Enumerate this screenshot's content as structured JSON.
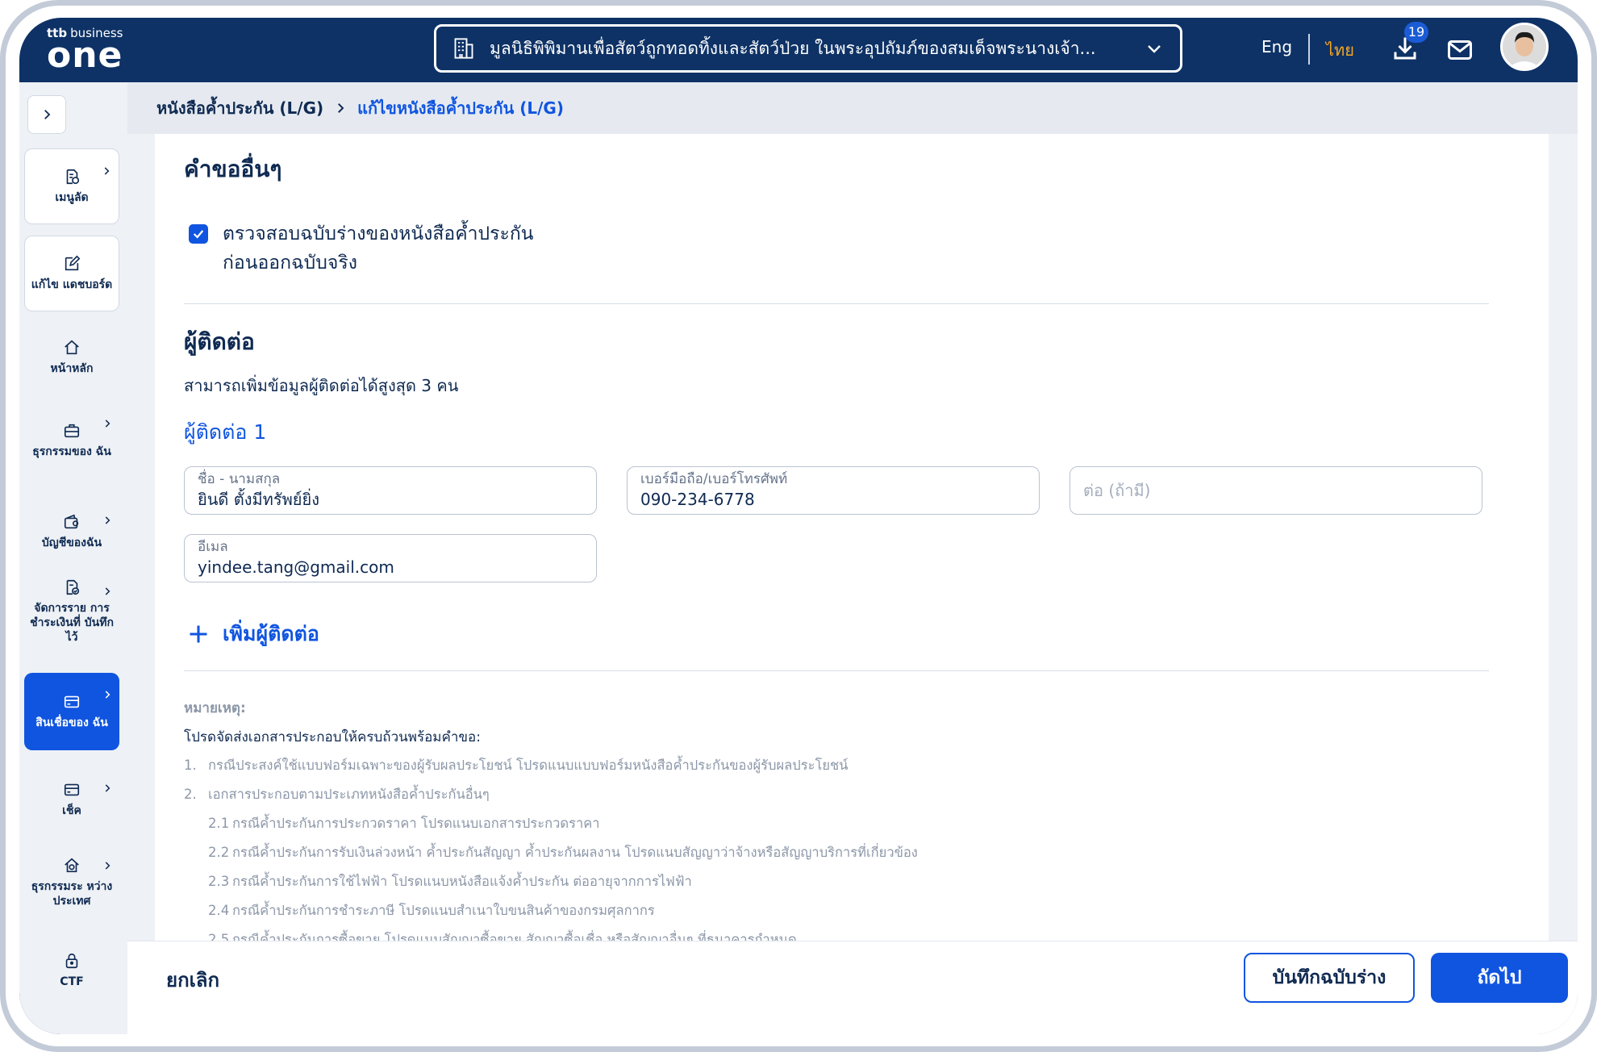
{
  "header": {
    "logo_brand": "ttb",
    "logo_business": "business",
    "logo_main": "one",
    "company_name": "มูลนิธิพิพิมานเพื่อสัตว์ถูกทอดทิ้งและสัตว์ป่วย ในพระอุปถัมภ์ของสมเด็จพระนางเจ้า...",
    "lang_en": "Eng",
    "lang_th": "ไทย",
    "download_badge": "19",
    "accent_color": "#1055e0",
    "active_lang_color": "#f5a623"
  },
  "sidebar": {
    "items": [
      {
        "label": "เมนูลัด",
        "icon": "document-star-icon"
      },
      {
        "label": "แก้ไข แดชบอร์ด",
        "icon": "edit-icon"
      },
      {
        "label": "หน้าหลัก",
        "icon": "home-icon"
      },
      {
        "label": "ธุรกรรมของ ฉัน",
        "icon": "briefcase-icon"
      },
      {
        "label": "บัญชีของฉัน",
        "icon": "wallet-icon"
      },
      {
        "label": "จัดการราย การชำระเงินที่ บันทึกไว้",
        "icon": "document-check-icon"
      },
      {
        "label": "สินเชื่อของ ฉัน",
        "icon": "card-icon"
      },
      {
        "label": "เช็ค",
        "icon": "cheque-icon"
      },
      {
        "label": "ธุรกรรมระ หว่างประเทศ",
        "icon": "globe-home-icon"
      },
      {
        "label": "CTF",
        "icon": "lock-icon"
      }
    ]
  },
  "breadcrumb": {
    "parent": "หนังสือค้ำประกัน (L/G)",
    "current": "แก้ไขหนังสือค้ำประกัน (L/G)"
  },
  "other_requests": {
    "title": "คำขออื่นๆ",
    "checkbox_label_line1": "ตรวจสอบฉบับร่างของหนังสือค้ำประกัน",
    "checkbox_label_line2": "ก่อนออกฉบับจริง",
    "checked": true
  },
  "contacts": {
    "title": "ผู้ติดต่อ",
    "subtitle": "สามารถเพิ่มข้อมูลผู้ติดต่อได้สูงสุด 3 คน",
    "contact_title": "ผู้ติดต่อ 1",
    "name_label": "ชื่อ - นามสกุล",
    "name_value": "ยินดี ตั้งมีทรัพย์ยิ่ง",
    "phone_label": "เบอร์มือถือ/เบอร์โทรศัพท์",
    "phone_value": "090-234-6778",
    "ext_placeholder": "ต่อ (ถ้ามี)",
    "email_label": "อีเมล",
    "email_value": "yindee.tang@gmail.com",
    "add_label": "เพิ่มผู้ติดต่อ"
  },
  "notes": {
    "heading": "หมายเหตุ:",
    "sub": "โปรดจัดส่งเอกสารประกอบให้ครบถ้วนพร้อมคำขอ:",
    "items": [
      {
        "num": "1.",
        "text": "กรณีประสงค์ใช้แบบฟอร์มเฉพาะของผู้รับผลประโยชน์ โปรดแนบแบบฟอร์มหนังสือค้ำประกันของผู้รับผลประโยชน์"
      },
      {
        "num": "2.",
        "text": "เอกสารประกอบตามประเภทหนังสือค้ำประกันอื่นๆ"
      },
      {
        "num": "2.1",
        "text": "กรณีค้ำประกันการประกวดราคา โปรดแนบเอกสารประกวดราคา"
      },
      {
        "num": "2.2",
        "text": "กรณีค้ำประกันการรับเงินล่วงหน้า ค้ำประกันสัญญา ค้ำประกันผลงาน โปรดแนบสัญญาว่าจ้างหรือสัญญาบริการที่เกี่ยวข้อง"
      },
      {
        "num": "2.3",
        "text": "กรณีค้ำประกันการใช้ไฟฟ้า โปรดแนบหนังสือแจ้งค้ำประกัน ต่ออายุจากการไฟฟ้า"
      },
      {
        "num": "2.4",
        "text": "กรณีค้ำประกันการชำระภาษี โปรดแนบสำเนาใบขนสินค้าของกรมศุลกากร"
      },
      {
        "num": "2.5",
        "text": "กรณีค้ำประกันการซื้อขาย โปรดแนบสัญญาซื้อขาย สัญญาซื้อเชื่อ หรือสัญญาอื่นๆ ที่ธนาคารกำหนด"
      }
    ]
  },
  "footer": {
    "cancel": "ยกเลิก",
    "save_draft": "บันทึกฉบับร่าง",
    "next": "ถัดไป"
  }
}
